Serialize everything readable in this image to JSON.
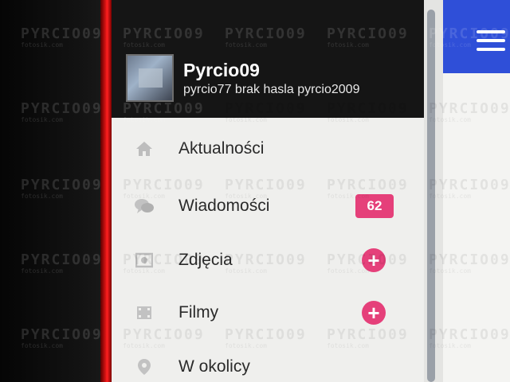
{
  "profile": {
    "name": "Pyrcio09",
    "description": "pyrcio77 brak hasla pyrcio2009"
  },
  "menu": {
    "items": [
      {
        "label": "Aktualności",
        "icon": "home-icon"
      },
      {
        "label": "Wiadomości",
        "icon": "chat-bubbles-icon",
        "badge": "62"
      },
      {
        "label": "Zdjęcia",
        "icon": "photo-icon",
        "action": "+"
      },
      {
        "label": "Filmy",
        "icon": "film-icon",
        "action": "+"
      },
      {
        "label": "W okolicy",
        "icon": "location-pin-icon"
      }
    ]
  },
  "watermark": {
    "text": "PYRCIO09",
    "subtext": "fotosik.com"
  },
  "colors": {
    "accent": "#e5407a",
    "header_blue": "#2f4fd8",
    "drawer_header": "#151515",
    "red_edge": "#d31212"
  }
}
